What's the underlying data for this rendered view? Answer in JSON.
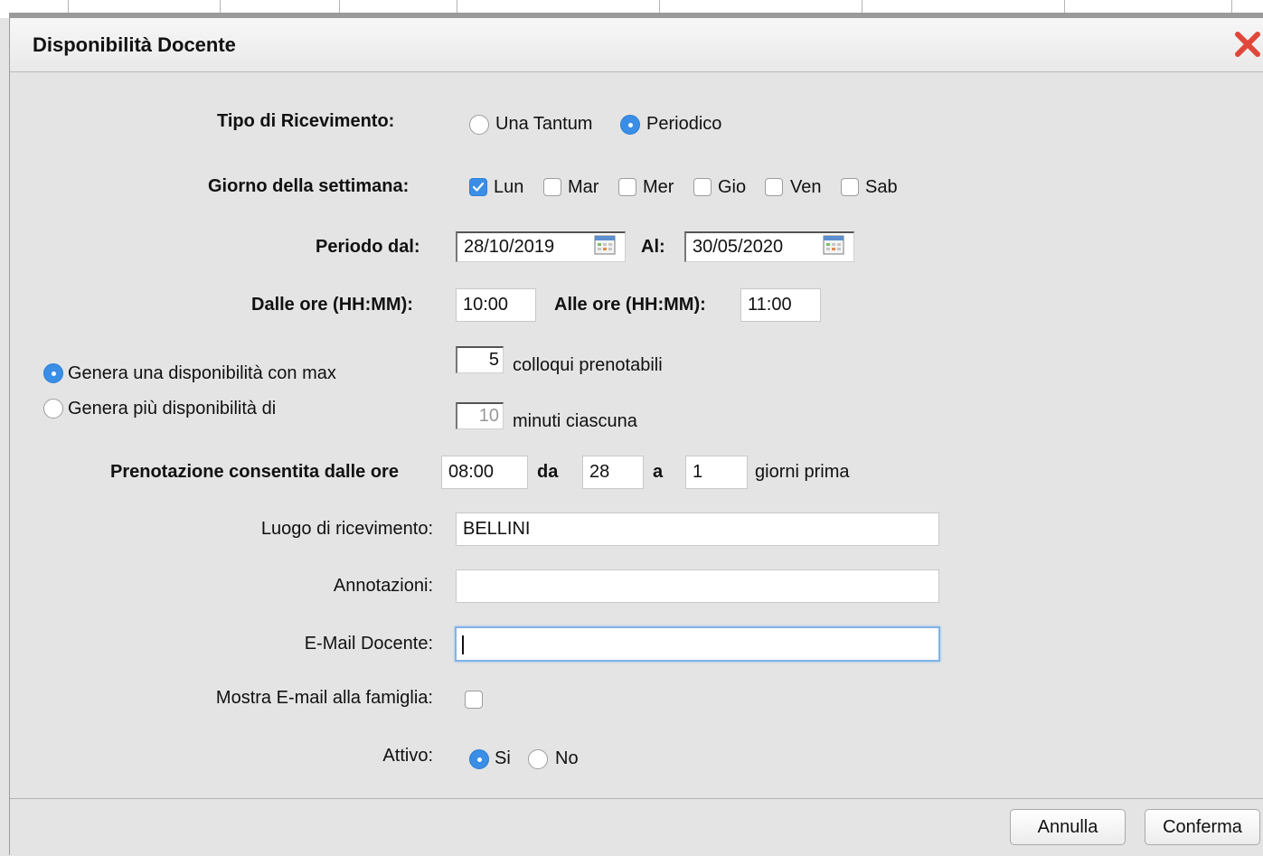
{
  "dialog": {
    "title": "Disponibilità Docente",
    "close_icon": "close-x-icon",
    "accent_color": "#3a8ee6",
    "close_color": "#e0473a"
  },
  "form": {
    "tipo_label": "Tipo di Ricevimento:",
    "tipo_options": [
      {
        "label": "Una Tantum",
        "selected": false
      },
      {
        "label": "Periodico",
        "selected": true
      }
    ],
    "giorno_label": "Giorno della settimana:",
    "days": [
      {
        "label": "Lun",
        "checked": true
      },
      {
        "label": "Mar",
        "checked": false
      },
      {
        "label": "Mer",
        "checked": false
      },
      {
        "label": "Gio",
        "checked": false
      },
      {
        "label": "Ven",
        "checked": false
      },
      {
        "label": "Sab",
        "checked": false
      }
    ],
    "periodo_label": "Periodo dal:",
    "periodo_dal": "28/10/2019",
    "al_label": "Al:",
    "periodo_al": "30/05/2020",
    "calendar_icon": "calendar-icon",
    "dalle_label": "Dalle ore (HH:MM):",
    "dalle_value": "10:00",
    "alle_label": "Alle ore (HH:MM):",
    "alle_value": "11:00",
    "genera_max_label": "Genera una disponibilità con max",
    "genera_max_selected": true,
    "max_value": "5",
    "colloqui_label": "colloqui prenotabili",
    "genera_piu_label": "Genera più disponibilità di",
    "genera_piu_selected": false,
    "minuti_value": "10",
    "minuti_label": "minuti ciascuna",
    "prenotazione_label": "Prenotazione consentita dalle ore",
    "prenotazione_ore": "08:00",
    "da_label": "da",
    "da_value": "28",
    "a_label": "a",
    "a_value": "1",
    "giorni_label": "giorni prima",
    "luogo_label": "Luogo di ricevimento:",
    "luogo_value": "BELLINI",
    "annotazioni_label": "Annotazioni:",
    "annotazioni_value": "",
    "email_label": "E-Mail Docente:",
    "email_value": "",
    "mostra_label": "Mostra E-mail alla famiglia:",
    "mostra_checked": false,
    "attivo_label": "Attivo:",
    "attivo_options": [
      {
        "label": "Si",
        "selected": true
      },
      {
        "label": "No",
        "selected": false
      }
    ]
  },
  "footer": {
    "annulla_label": "Annulla",
    "conferma_label": "Conferma"
  }
}
